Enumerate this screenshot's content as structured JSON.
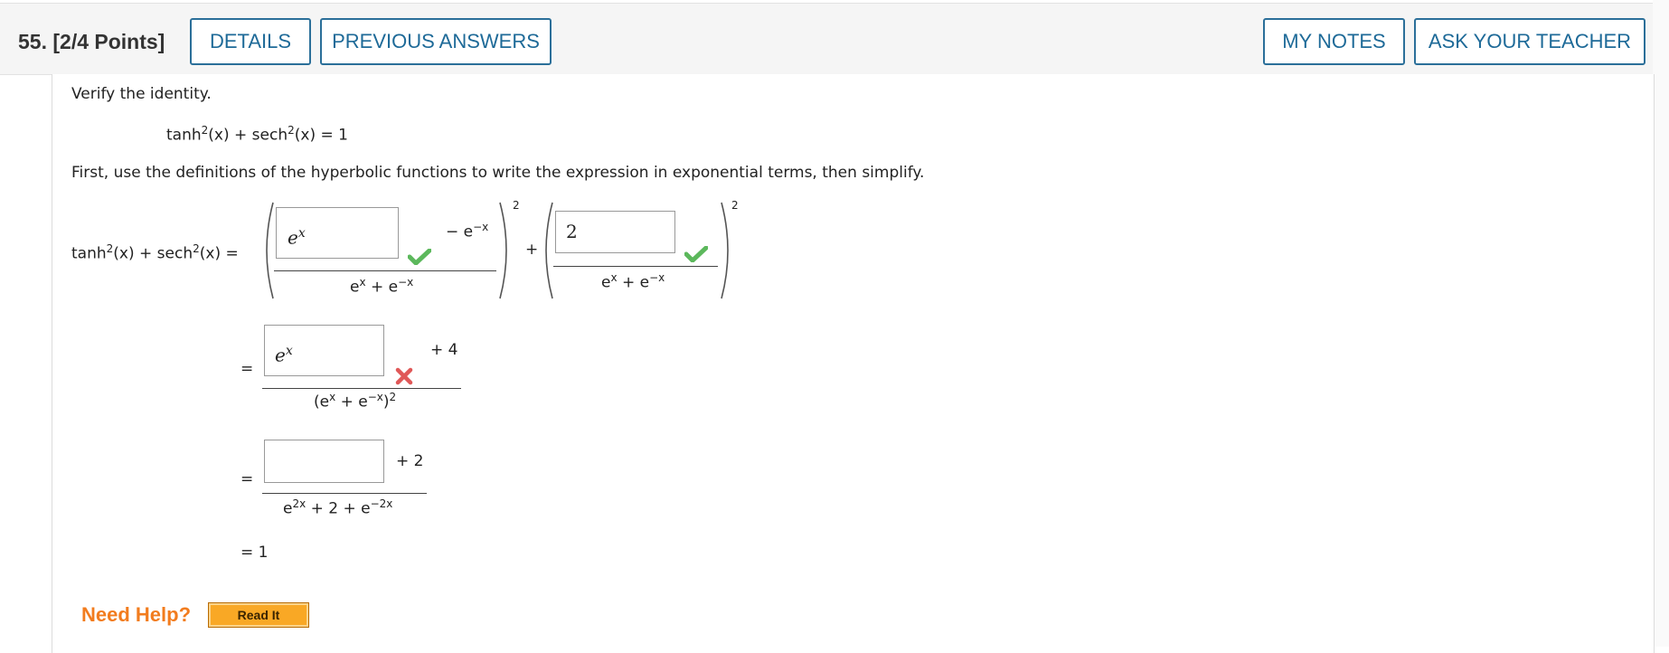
{
  "header": {
    "question_number": "55.",
    "points": "[2/4 Points]",
    "details_button": "DETAILS",
    "previous_answers_button": "PREVIOUS ANSWERS",
    "my_notes_button": "MY NOTES",
    "ask_teacher_button": "ASK YOUR TEACHER"
  },
  "problem": {
    "instruction": "Verify the identity.",
    "identity": {
      "lhs": "tanh",
      "exp": "2",
      "arg": "(x) + sech",
      "exp2": "2",
      "rhs": "(x) = 1"
    },
    "directions": "First, use the definitions of the hyperbolic functions to write the expression in exponential terms, then simplify.",
    "step1": {
      "lhs_tanh": "tanh",
      "exp_a": "2",
      "lhs_mid": "(x) + sech",
      "exp_b": "2",
      "lhs_end": "(x) =",
      "frac1_answer": "e",
      "frac1_answer_exp": "x",
      "frac1_suffix": "− e",
      "frac1_suffix_exp": "−x",
      "frac1_denom": "e",
      "frac1_denom_exp": "x",
      "frac1_denom_mid": " + e",
      "frac1_denom_exp2": "−x",
      "outer_exp1": "2",
      "plus": "+",
      "frac2_answer": "2",
      "frac2_denom": "e",
      "frac2_denom_exp": "x",
      "frac2_denom_mid": " + e",
      "frac2_denom_exp2": "−x",
      "outer_exp2": "2",
      "frac1_status": "correct",
      "frac2_status": "correct"
    },
    "step2": {
      "equals": "=",
      "answer": "e",
      "answer_exp": "x",
      "suffix": "+ 4",
      "denom_open": "(e",
      "denom_exp": "x",
      "denom_mid": " + e",
      "denom_exp2": "−x",
      "denom_close": ")",
      "denom_outer_exp": "2",
      "status": "incorrect"
    },
    "step3": {
      "equals": "=",
      "answer": "",
      "suffix": "+ 2",
      "denom_a": "e",
      "denom_exp": "2x",
      "denom_mid": " + 2 + e",
      "denom_exp2": "−2x"
    },
    "step4": {
      "result": "= 1"
    }
  },
  "help": {
    "need_help_label": "Need Help?",
    "read_it_button": "Read It"
  },
  "colors": {
    "accent": "#1e6a98",
    "correct": "#5cb85c",
    "incorrect": "#e05858",
    "help": "#f27c1e"
  }
}
